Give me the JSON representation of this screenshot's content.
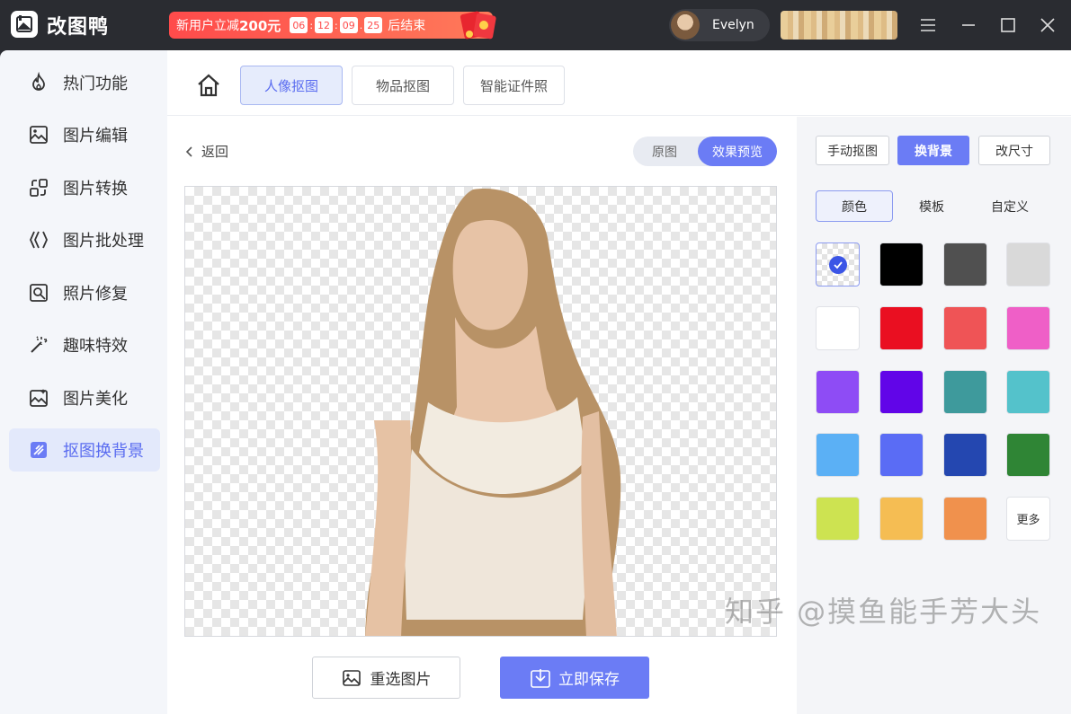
{
  "app": {
    "name": "改图鸭"
  },
  "promo": {
    "text": "新用户立减",
    "amount": "200元",
    "timer": [
      "06",
      "12",
      "09",
      "25"
    ],
    "suffix": "后结束"
  },
  "user": {
    "name": "Evelyn"
  },
  "sidebar": {
    "items": [
      {
        "label": "热门功能",
        "icon": "flame-icon"
      },
      {
        "label": "图片编辑",
        "icon": "image-edit-icon"
      },
      {
        "label": "图片转换",
        "icon": "convert-icon"
      },
      {
        "label": "图片批处理",
        "icon": "batch-icon"
      },
      {
        "label": "照片修复",
        "icon": "photo-repair-icon"
      },
      {
        "label": "趣味特效",
        "icon": "magic-wand-icon"
      },
      {
        "label": "图片美化",
        "icon": "image-beautify-icon"
      },
      {
        "label": "抠图换背景",
        "icon": "cutout-icon",
        "active": true
      }
    ]
  },
  "topnav": {
    "tabs": [
      {
        "label": "人像抠图",
        "active": true
      },
      {
        "label": "物品抠图"
      },
      {
        "label": "智能证件照"
      }
    ]
  },
  "editor": {
    "back_label": "返回",
    "toggle": {
      "original": "原图",
      "preview": "效果预览",
      "selected": "效果预览"
    },
    "reselect_label": "重选图片",
    "save_label": "立即保存"
  },
  "panel": {
    "modes": [
      {
        "label": "手动抠图"
      },
      {
        "label": "换背景",
        "active": true
      },
      {
        "label": "改尺寸"
      }
    ],
    "subtabs": [
      {
        "label": "颜色",
        "active": true
      },
      {
        "label": "模板"
      },
      {
        "label": "自定义"
      }
    ],
    "swatches": [
      "transparent",
      "#000000",
      "#505050",
      "#d9d9d9",
      "#ffffff",
      "#ea0f21",
      "#ef5456",
      "#ef5fc7",
      "#8e4cf5",
      "#6105e8",
      "#3e9a9c",
      "#54c2cb",
      "#5bb0f5",
      "#5a6cf5",
      "#2447b0",
      "#2f8535",
      "#cde351",
      "#f5bd53",
      "#f0914d",
      "more"
    ],
    "more_label": "更多",
    "accent": "#6b7cf5"
  },
  "watermark": "知乎 @摸鱼能手芳大头"
}
